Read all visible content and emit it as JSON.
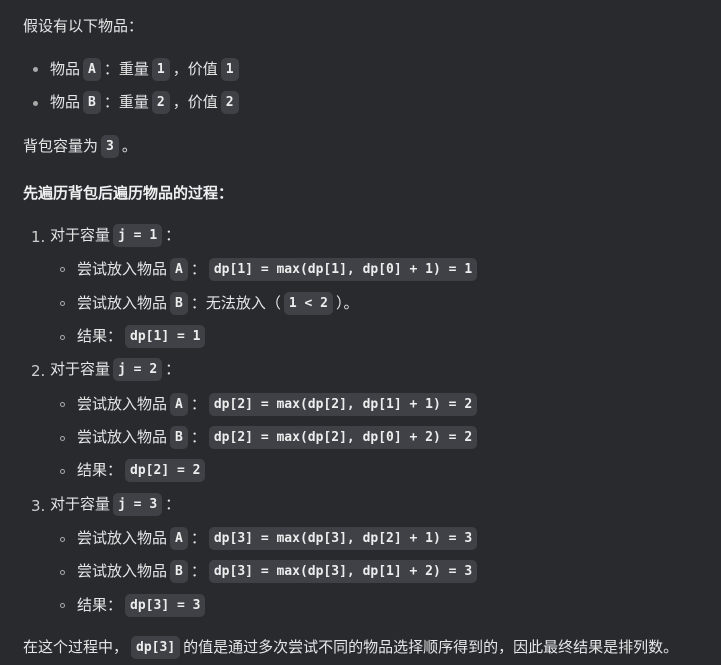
{
  "intro": "假设有以下物品：",
  "items": [
    {
      "prefix": "物品",
      "name": "A",
      "colon": "：重量",
      "weight": "1",
      "sep": "，价值",
      "value": "1"
    },
    {
      "prefix": "物品",
      "name": "B",
      "colon": "：重量",
      "weight": "2",
      "sep": "，价值",
      "value": "2"
    }
  ],
  "capacity": {
    "prefix": "背包容量为",
    "value": "3",
    "suffix": "。"
  },
  "heading": "先遍历背包后遍历物品的过程：",
  "steps": [
    {
      "num": "1.",
      "label": "对于容量",
      "code": "j = 1",
      "colon": "：",
      "subs": [
        {
          "text": "尝试放入物品",
          "item": "A",
          "colon": "：",
          "code": "dp[1] = max(dp[1], dp[0] + 1) = 1"
        },
        {
          "text": "尝试放入物品",
          "item": "B",
          "colon": "：无法放入（",
          "code": "1 < 2",
          "tail": "）。"
        },
        {
          "text": "结果：",
          "code": "dp[1] = 1"
        }
      ]
    },
    {
      "num": "2.",
      "label": "对于容量",
      "code": "j = 2",
      "colon": "：",
      "subs": [
        {
          "text": "尝试放入物品",
          "item": "A",
          "colon": "：",
          "code": "dp[2] = max(dp[2], dp[1] + 1) = 2"
        },
        {
          "text": "尝试放入物品",
          "item": "B",
          "colon": "：",
          "code": "dp[2] = max(dp[2], dp[0] + 2) = 2"
        },
        {
          "text": "结果：",
          "code": "dp[2] = 2"
        }
      ]
    },
    {
      "num": "3.",
      "label": "对于容量",
      "code": "j = 3",
      "colon": "：",
      "subs": [
        {
          "text": "尝试放入物品",
          "item": "A",
          "colon": "：",
          "code": "dp[3] = max(dp[3], dp[2] + 1) = 3"
        },
        {
          "text": "尝试放入物品",
          "item": "B",
          "colon": "：",
          "code": "dp[3] = max(dp[3], dp[1] + 2) = 3"
        },
        {
          "text": "结果：",
          "code": "dp[3] = 3"
        }
      ]
    }
  ],
  "conclusion": {
    "prefix": "在这个过程中，",
    "code": "dp[3]",
    "suffix": "的值是通过多次尝试不同的物品选择顺序得到的，因此最终结果是排列数。"
  }
}
